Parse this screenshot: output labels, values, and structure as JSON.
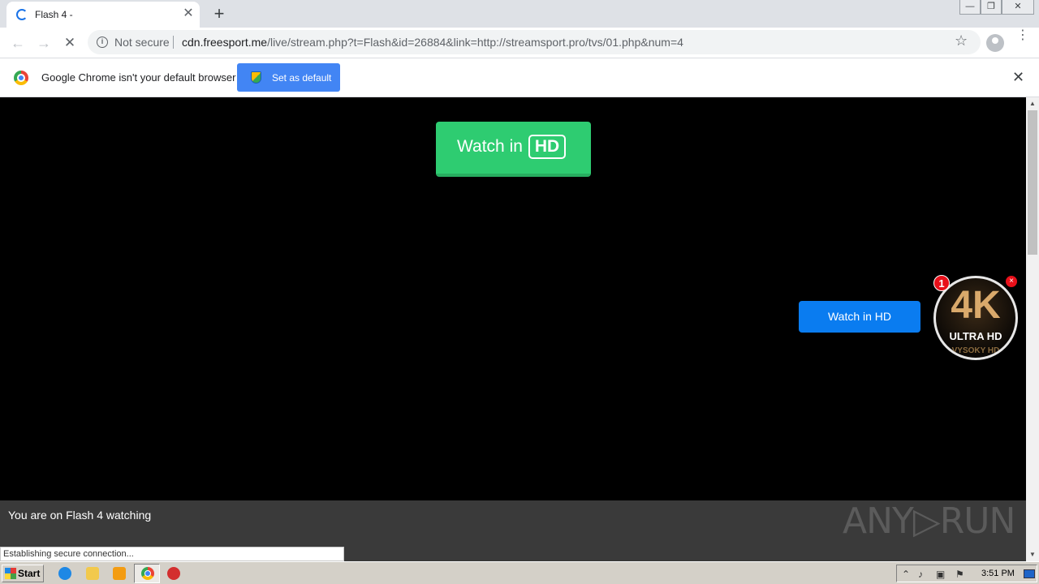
{
  "browser": {
    "tab": {
      "title": "Flash 4 -",
      "close": "✕"
    },
    "new_tab": "+",
    "window_controls": {
      "minimize": "—",
      "restore": "❐",
      "close": "✕"
    },
    "nav": {
      "back": "←",
      "forward": "→",
      "stop": "✕"
    },
    "omnibox": {
      "security_label": "Not secure",
      "url_host": "cdn.freesport.me",
      "url_rest": "/live/stream.php?t=Flash&id=26884&link=http://streamsport.pro/tvs/01.php&num=4"
    },
    "star": "☆",
    "menu": "⋮"
  },
  "infobar": {
    "message": "Google Chrome isn't your default browser",
    "button_label": "Set as default",
    "close": "✕"
  },
  "page": {
    "watch_hd_big": {
      "prefix": "Watch in",
      "hd": "HD"
    },
    "watch_hd_small": "Watch in HD",
    "promo": {
      "big": "4K",
      "sub": "ULTRA HD",
      "sub2": "VYSOKY HD",
      "badge": "1",
      "close": "×"
    },
    "footer_text": "You are on Flash 4 watching",
    "watermark": "ANY▷RUN",
    "status_text": "Establishing secure connection..."
  },
  "taskbar": {
    "start_label": "Start",
    "clock": "3:51 PM"
  },
  "colors": {
    "accent_blue": "#4285f4",
    "watch_green": "#2ecc71",
    "watch_blue": "#0a7cf0",
    "badge_red": "#e8101a"
  }
}
